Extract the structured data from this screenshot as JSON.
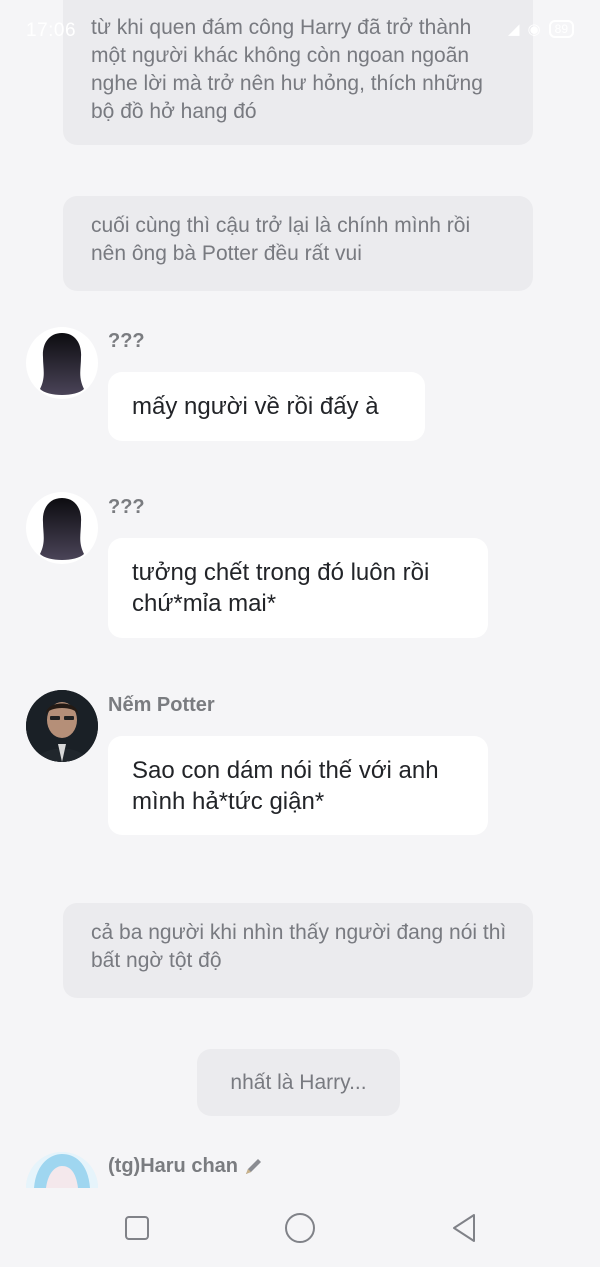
{
  "status_bar": {
    "time": "17:06",
    "battery": "89"
  },
  "story": [
    {
      "id": "n1",
      "text": "từ khi quen đám công Harry đã trở thành một người khác không còn ngoan ngoãn nghe lời mà trở nên hư hỏng, thích những bộ đồ hở hang đó"
    },
    {
      "id": "n2",
      "text": "cuối cùng thì cậu trở lại là chính mình rồi nên ông bà Potter đều rất vui"
    }
  ],
  "messages": [
    {
      "sender": "???",
      "text": "mấy người về rồi đấy à"
    },
    {
      "sender": "???",
      "text": "tưởng chết trong đó luôn rồi chứ*mỉa mai*"
    },
    {
      "sender": "Nếm Potter",
      "text": "Sao con dám nói thế với anh mình hả*tức giận*"
    }
  ],
  "story_after": [
    {
      "text": "cả ba người khi nhìn thấy người đang nói thì bất ngờ tột độ"
    },
    {
      "text": "nhất là Harry..."
    }
  ],
  "last_sender": {
    "name": "(tg)Haru chan"
  },
  "colors": {
    "background": "#f5f5f7",
    "narration_bg": "#ebebee",
    "bubble_bg": "#ffffff"
  }
}
